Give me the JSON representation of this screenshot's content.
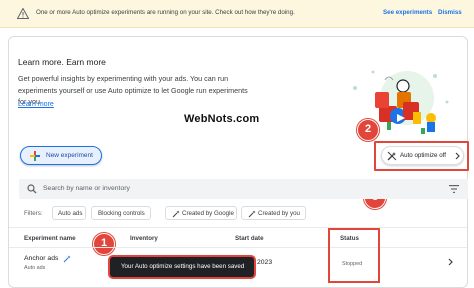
{
  "banner": {
    "message": "One or more Auto optimize experiments are running on your site. Check out how they're doing.",
    "see_label": "See experiments",
    "dismiss_label": "Dismiss"
  },
  "learn": {
    "title": "Learn more. Earn more",
    "body": "Get powerful insights by experimenting with your ads. You can run experiments yourself or use Auto optimize to let Google run experiments for you.",
    "link": "Learn more"
  },
  "watermark": "WebNots.com",
  "toolbar": {
    "new_experiment_label": "New experiment",
    "auto_optimize_label": "Auto optimize off"
  },
  "search": {
    "placeholder": "Search by name or inventory"
  },
  "filters": {
    "label": "Filters:",
    "chips": [
      "Auto ads",
      "Blocking controls",
      "Created by Google",
      "Created by you"
    ]
  },
  "table": {
    "columns": [
      "Experiment name",
      "Inventory",
      "Start date",
      "Status"
    ],
    "rows": [
      {
        "name": "Anchor ads",
        "sub": "Auto ads",
        "start_date": "2023",
        "status": "Stopped"
      }
    ]
  },
  "toast": {
    "message": "Your Auto optimize settings have been saved"
  },
  "annotations": [
    "1",
    "2",
    "3"
  ],
  "colors": {
    "accent": "#1a73e8",
    "banner_bg": "#fef7e0",
    "highlight": "#e2463b"
  }
}
